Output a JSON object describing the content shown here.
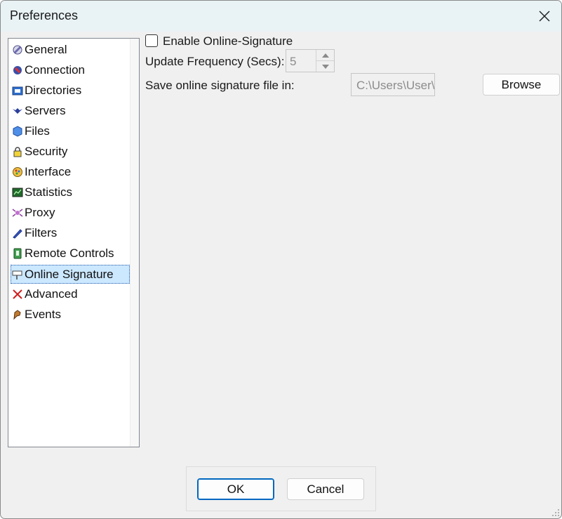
{
  "window": {
    "title": "Preferences"
  },
  "sidebar": {
    "items": [
      {
        "label": "General",
        "icon": "general-icon"
      },
      {
        "label": "Connection",
        "icon": "connection-icon"
      },
      {
        "label": "Directories",
        "icon": "directories-icon"
      },
      {
        "label": "Servers",
        "icon": "servers-icon"
      },
      {
        "label": "Files",
        "icon": "files-icon"
      },
      {
        "label": "Security",
        "icon": "lock-icon"
      },
      {
        "label": "Interface",
        "icon": "interface-icon"
      },
      {
        "label": "Statistics",
        "icon": "statistics-icon"
      },
      {
        "label": "Proxy",
        "icon": "proxy-icon"
      },
      {
        "label": "Filters",
        "icon": "filters-icon"
      },
      {
        "label": "Remote Controls",
        "icon": "remote-controls-icon"
      },
      {
        "label": "Online Signature",
        "icon": "signpost-icon",
        "selected": true
      },
      {
        "label": "Advanced",
        "icon": "advanced-icon"
      },
      {
        "label": "Events",
        "icon": "events-icon"
      }
    ]
  },
  "main": {
    "enable_label": "Enable Online-Signature",
    "enable_checked": false,
    "frequency_label": "Update Frequency (Secs):",
    "frequency_value": "5",
    "save_label": "Save online signature file in:",
    "path_value": "C:\\Users\\User\\",
    "browse_label": "Browse"
  },
  "footer": {
    "ok_label": "OK",
    "cancel_label": "Cancel"
  },
  "colors": {
    "titlebar": "#e9f3f6",
    "selection": "#cce8ff",
    "accent": "#0067c0"
  }
}
